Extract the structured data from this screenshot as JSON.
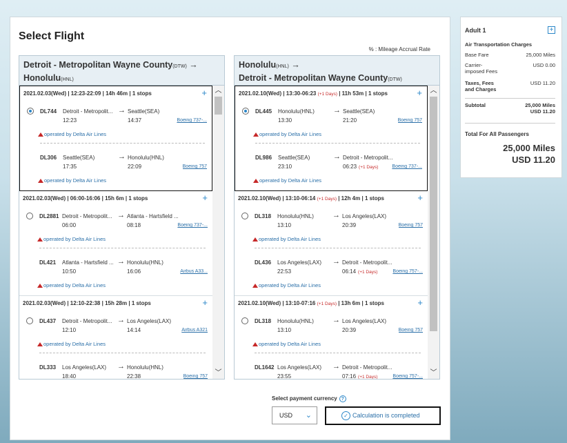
{
  "page_title": "Select Flight",
  "mileage_note": "% : Mileage Accrual Rate",
  "outbound": {
    "from": "Detroit - Metropolitan Wayne County",
    "from_code": "(DTW)",
    "to": "Honolulu",
    "to_code": "(HNL)",
    "options": [
      {
        "date": "2021.02.03(Wed)",
        "time": "12:23-22:09",
        "next_day": "",
        "duration": "14h 46m",
        "stops": "1 stops",
        "selected": true,
        "segments": [
          {
            "flight": "DL744",
            "from": "Detroit - Metropolit...",
            "to": "Seattle(SEA)",
            "dep": "12:23",
            "arr": "14:37",
            "next_day": "",
            "aircraft": "Boeing 737-...",
            "operator": "operated by Delta Air Lines"
          },
          {
            "flight": "DL306",
            "from": "Seattle(SEA)",
            "to": "Honolulu(HNL)",
            "dep": "17:35",
            "arr": "22:09",
            "next_day": "",
            "aircraft": "Boeing 757",
            "operator": "operated by Delta Air Lines"
          }
        ]
      },
      {
        "date": "2021.02.03(Wed)",
        "time": "06:00-16:06",
        "next_day": "",
        "duration": "15h 6m",
        "stops": "1 stops",
        "selected": false,
        "segments": [
          {
            "flight": "DL2881",
            "from": "Detroit - Metropolit...",
            "to": "Atlanta - Hartsfield ...",
            "dep": "06:00",
            "arr": "08:18",
            "next_day": "",
            "aircraft": "Boeing 737-...",
            "operator": "operated by Delta Air Lines"
          },
          {
            "flight": "DL421",
            "from": "Atlanta - Hartsfield ...",
            "to": "Honolulu(HNL)",
            "dep": "10:50",
            "arr": "16:06",
            "next_day": "",
            "aircraft": "Airbus A33...",
            "operator": "operated by Delta Air Lines"
          }
        ]
      },
      {
        "date": "2021.02.03(Wed)",
        "time": "12:10-22:38",
        "next_day": "",
        "duration": "15h 28m",
        "stops": "1 stops",
        "selected": false,
        "segments": [
          {
            "flight": "DL437",
            "from": "Detroit - Metropolit...",
            "to": "Los Angeles(LAX)",
            "dep": "12:10",
            "arr": "14:14",
            "next_day": "",
            "aircraft": "Airbus A321",
            "operator": "operated by Delta Air Lines"
          },
          {
            "flight": "DL333",
            "from": "Los Angeles(LAX)",
            "to": "Honolulu(HNL)",
            "dep": "18:40",
            "arr": "22:38",
            "next_day": "",
            "aircraft": "Boeing 757",
            "operator": ""
          }
        ]
      }
    ]
  },
  "inbound": {
    "from": "Honolulu",
    "from_code": "(HNL)",
    "to": "Detroit - Metropolitan Wayne County",
    "to_code": "(DTW)",
    "options": [
      {
        "date": "2021.02.10(Wed)",
        "time": "13:30-06:23",
        "next_day": "(+1 Days)",
        "duration": "11h 53m",
        "stops": "1 stops",
        "selected": true,
        "segments": [
          {
            "flight": "DL445",
            "from": "Honolulu(HNL)",
            "to": "Seattle(SEA)",
            "dep": "13:30",
            "arr": "21:20",
            "next_day": "",
            "aircraft": "Boeing 757",
            "operator": "operated by Delta Air Lines"
          },
          {
            "flight": "DL986",
            "from": "Seattle(SEA)",
            "to": "Detroit - Metropolit...",
            "dep": "23:10",
            "arr": "06:23",
            "next_day": "(+1 Days)",
            "aircraft": "Boeing 737-...",
            "operator": "operated by Delta Air Lines"
          }
        ]
      },
      {
        "date": "2021.02.10(Wed)",
        "time": "13:10-06:14",
        "next_day": "(+1 Days)",
        "duration": "12h 4m",
        "stops": "1 stops",
        "selected": false,
        "segments": [
          {
            "flight": "DL318",
            "from": "Honolulu(HNL)",
            "to": "Los Angeles(LAX)",
            "dep": "13:10",
            "arr": "20:39",
            "next_day": "",
            "aircraft": "Boeing 757",
            "operator": "operated by Delta Air Lines"
          },
          {
            "flight": "DL436",
            "from": "Los Angeles(LAX)",
            "to": "Detroit - Metropolit...",
            "dep": "22:53",
            "arr": "06:14",
            "next_day": "(+1 Days)",
            "aircraft": "Boeing 757-...",
            "operator": "operated by Delta Air Lines"
          }
        ]
      },
      {
        "date": "2021.02.10(Wed)",
        "time": "13:10-07:16",
        "next_day": "(+1 Days)",
        "duration": "13h 6m",
        "stops": "1 stops",
        "selected": false,
        "segments": [
          {
            "flight": "DL318",
            "from": "Honolulu(HNL)",
            "to": "Los Angeles(LAX)",
            "dep": "13:10",
            "arr": "20:39",
            "next_day": "",
            "aircraft": "Boeing 757",
            "operator": "operated by Delta Air Lines"
          },
          {
            "flight": "DL1642",
            "from": "Los Angeles(LAX)",
            "to": "Detroit - Metropolit...",
            "dep": "23:55",
            "arr": "07:16",
            "next_day": "(+1 Days)",
            "aircraft": "Boeing 757-...",
            "operator": ""
          }
        ]
      }
    ]
  },
  "currency": {
    "label": "Select payment currency",
    "help": "?",
    "value": "USD"
  },
  "calc_button": "Calculation is completed",
  "summary": {
    "passenger": "Adult 1",
    "section": "Air Transportation Charges",
    "base_fare_label": "Base Fare",
    "base_fare": "25,000 Miles",
    "carrier_label_1": "Carrier-",
    "carrier_label_2": "imposed Fees",
    "carrier": "USD 0.00",
    "taxes_label_1": "Taxes, Fees",
    "taxes_label_2": "and Charges",
    "taxes": "USD 11.20",
    "subtotal_label": "Subtotal",
    "subtotal_miles": "25,000 Miles",
    "subtotal_usd": "USD 11.20",
    "total_label": "Total For All Passengers",
    "total_miles": "25,000 Miles",
    "total_usd": "USD 11.20"
  },
  "colors": {
    "accent": "#2a86c8",
    "next_day": "#c62828",
    "link": "#2a6fa8"
  }
}
